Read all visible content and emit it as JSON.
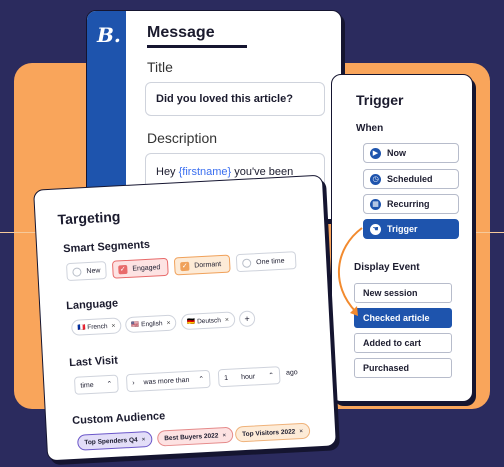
{
  "message": {
    "logo": "B.",
    "title": "Message",
    "title_label": "Title",
    "title_value": "Did you loved this article?",
    "description_label": "Description",
    "description_prefix": "Hey ",
    "description_token": "{firstname}",
    "description_suffix": " you've been"
  },
  "trigger": {
    "title": "Trigger",
    "when_label": "When",
    "when_options": [
      {
        "label": "Now",
        "icon": "play-icon",
        "glyph": "▶"
      },
      {
        "label": "Scheduled",
        "icon": "clock-icon",
        "glyph": "◷"
      },
      {
        "label": "Recurring",
        "icon": "calendar-icon",
        "glyph": "▦"
      },
      {
        "label": "Trigger",
        "icon": "hand-icon",
        "glyph": "☚"
      }
    ],
    "when_selected": "Trigger",
    "display_event_label": "Display Event",
    "events": [
      "New session",
      "Checked article",
      "Added to cart",
      "Purchased"
    ],
    "event_selected": "Checked article"
  },
  "targeting": {
    "title": "Targeting",
    "smart_segments_label": "Smart Segments",
    "segments": [
      {
        "label": "New",
        "state": "unchecked"
      },
      {
        "label": "Engaged",
        "state": "checked-red"
      },
      {
        "label": "Dormant",
        "state": "checked-orange"
      },
      {
        "label": "One time",
        "state": "unchecked"
      }
    ],
    "language_label": "Language",
    "languages": [
      {
        "label": "French",
        "flag": "🇫🇷"
      },
      {
        "label": "English",
        "flag": "🇺🇸"
      },
      {
        "label": "Deutsch",
        "flag": "🇩🇪"
      }
    ],
    "add_language": "+",
    "last_visit_label": "Last Visit",
    "last_visit": {
      "unit_select": "time",
      "comparator_select": "was more than",
      "amount": "1",
      "period_select": "hour",
      "suffix": "ago"
    },
    "custom_audience_label": "Custom Audience",
    "audiences": [
      {
        "label": "Top Spenders Q4",
        "color": "purple"
      },
      {
        "label": "Best Buyers 2022",
        "color": "pink"
      },
      {
        "label": "Top Visitors 2022",
        "color": "peach"
      }
    ]
  },
  "colors": {
    "background": "#2b2b5e",
    "accent_orange": "#f9a55b",
    "brand_blue": "#1e54ad"
  }
}
